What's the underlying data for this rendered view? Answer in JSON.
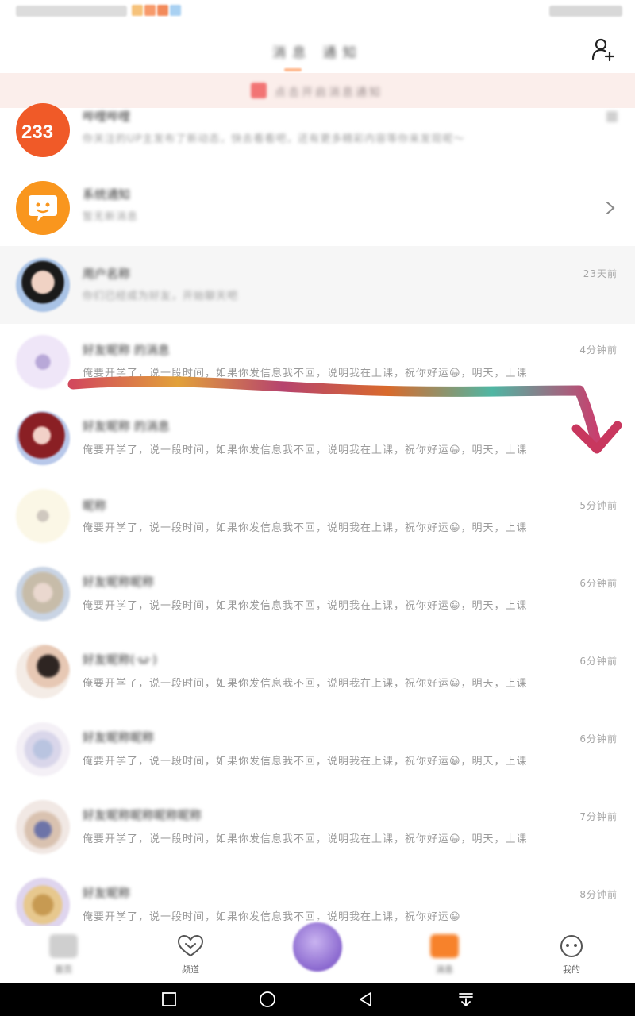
{
  "status": {
    "left": "Ilili",
    "right": "Ilili"
  },
  "header": {
    "title_primary": "消息",
    "title_secondary": "通知"
  },
  "banner": {
    "text": "点击开启消息通知"
  },
  "rows": [
    {
      "name": "哔哩哔哩",
      "preview": "你关注的UP主发布了新动态，快去看看吧，还有更多精彩内容等你来发现呢～",
      "time": ""
    },
    {
      "name": "系统通知",
      "preview": "暂无新消息",
      "time": ""
    },
    {
      "name": "用户名称",
      "preview": "你们已经成为好友，开始聊天吧",
      "time": "23天前"
    },
    {
      "name": "好友昵称 的消息",
      "preview": "俺要开学了，说一段时间，如果你发信息我不回，说明我在上课，祝你好运😀，明天，上课",
      "time": "4分钟前"
    },
    {
      "name": "好友昵称 的消息",
      "preview": "俺要开学了，说一段时间，如果你发信息我不回，说明我在上课，祝你好运😀，明天，上课",
      "time": ""
    },
    {
      "name": "昵称",
      "preview": "俺要开学了，说一段时间，如果你发信息我不回，说明我在上课，祝你好运😀，明天，上课",
      "time": "5分钟前"
    },
    {
      "name": "好友昵称昵称",
      "preview": "俺要开学了，说一段时间，如果你发信息我不回，说明我在上课，祝你好运😀，明天，上课",
      "time": "6分钟前"
    },
    {
      "name": "好友昵称(·ω·)",
      "preview": "俺要开学了，说一段时间，如果你发信息我不回，说明我在上课，祝你好运😀，明天，上课",
      "time": "6分钟前"
    },
    {
      "name": "好友昵称昵称",
      "preview": "俺要开学了，说一段时间，如果你发信息我不回，说明我在上课，祝你好运😀，明天，上课",
      "time": "6分钟前"
    },
    {
      "name": "好友昵称昵称昵称昵称",
      "preview": "俺要开学了，说一段时间，如果你发信息我不回，说明我在上课，祝你好运😀，明天，上课",
      "time": "7分钟前"
    },
    {
      "name": "好友昵称",
      "preview": "俺要开学了，说一段时间，如果你发信息我不回，说明我在上课，祝你好运😀",
      "time": "8分钟前"
    }
  ],
  "tabs": [
    {
      "label": "首页"
    },
    {
      "label": "频道"
    },
    {
      "label": ""
    },
    {
      "label": "消息"
    },
    {
      "label": "我的"
    }
  ],
  "colors": {
    "accent": "#fb7299",
    "orange": "#f7822b",
    "banner_bg": "#fbeeeb"
  }
}
